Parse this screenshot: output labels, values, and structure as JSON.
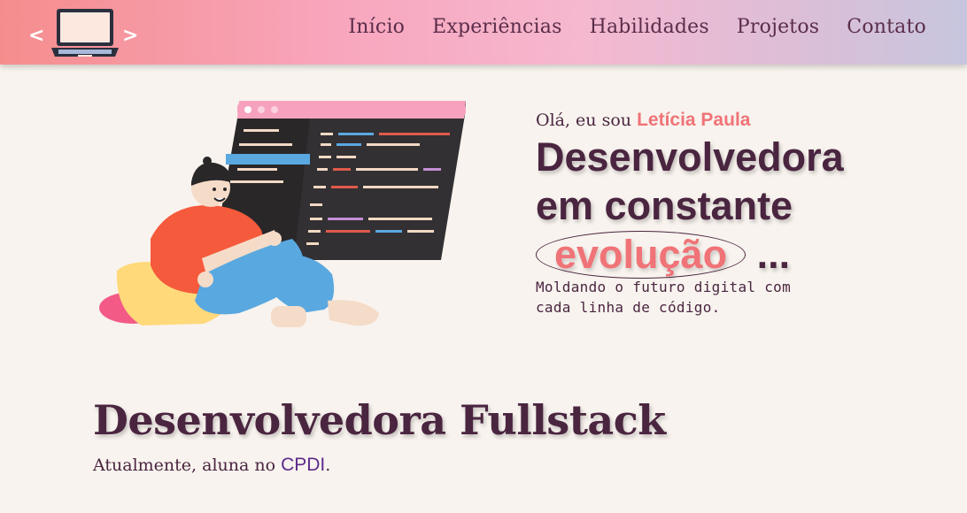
{
  "header": {
    "logo": {
      "left_glyph": "<",
      "right_glyph": ">",
      "icon": "laptop-icon"
    },
    "nav": [
      "Início",
      "Experiências",
      "Habilidades",
      "Projetos",
      "Contato"
    ]
  },
  "hero": {
    "greeting_prefix": "Olá, eu sou",
    "name": "Letícia Paula",
    "headline_line1": "Desenvolvedora",
    "headline_line2": "em constante",
    "headline_highlight": "evolução",
    "headline_suffix": "...",
    "subtitle": "Moldando o futuro digital com cada linha de código.",
    "illustration": "developer-with-laptop-illustration"
  },
  "section": {
    "title": "Desenvolvedora Fullstack",
    "subtitle_prefix": "Atualmente, aluna no",
    "subtitle_link": "CPDI",
    "subtitle_suffix": "."
  },
  "colors": {
    "accent": "#f07377",
    "text": "#4a2540",
    "link": "#5d2a8a",
    "background": "#f8f3ee"
  }
}
